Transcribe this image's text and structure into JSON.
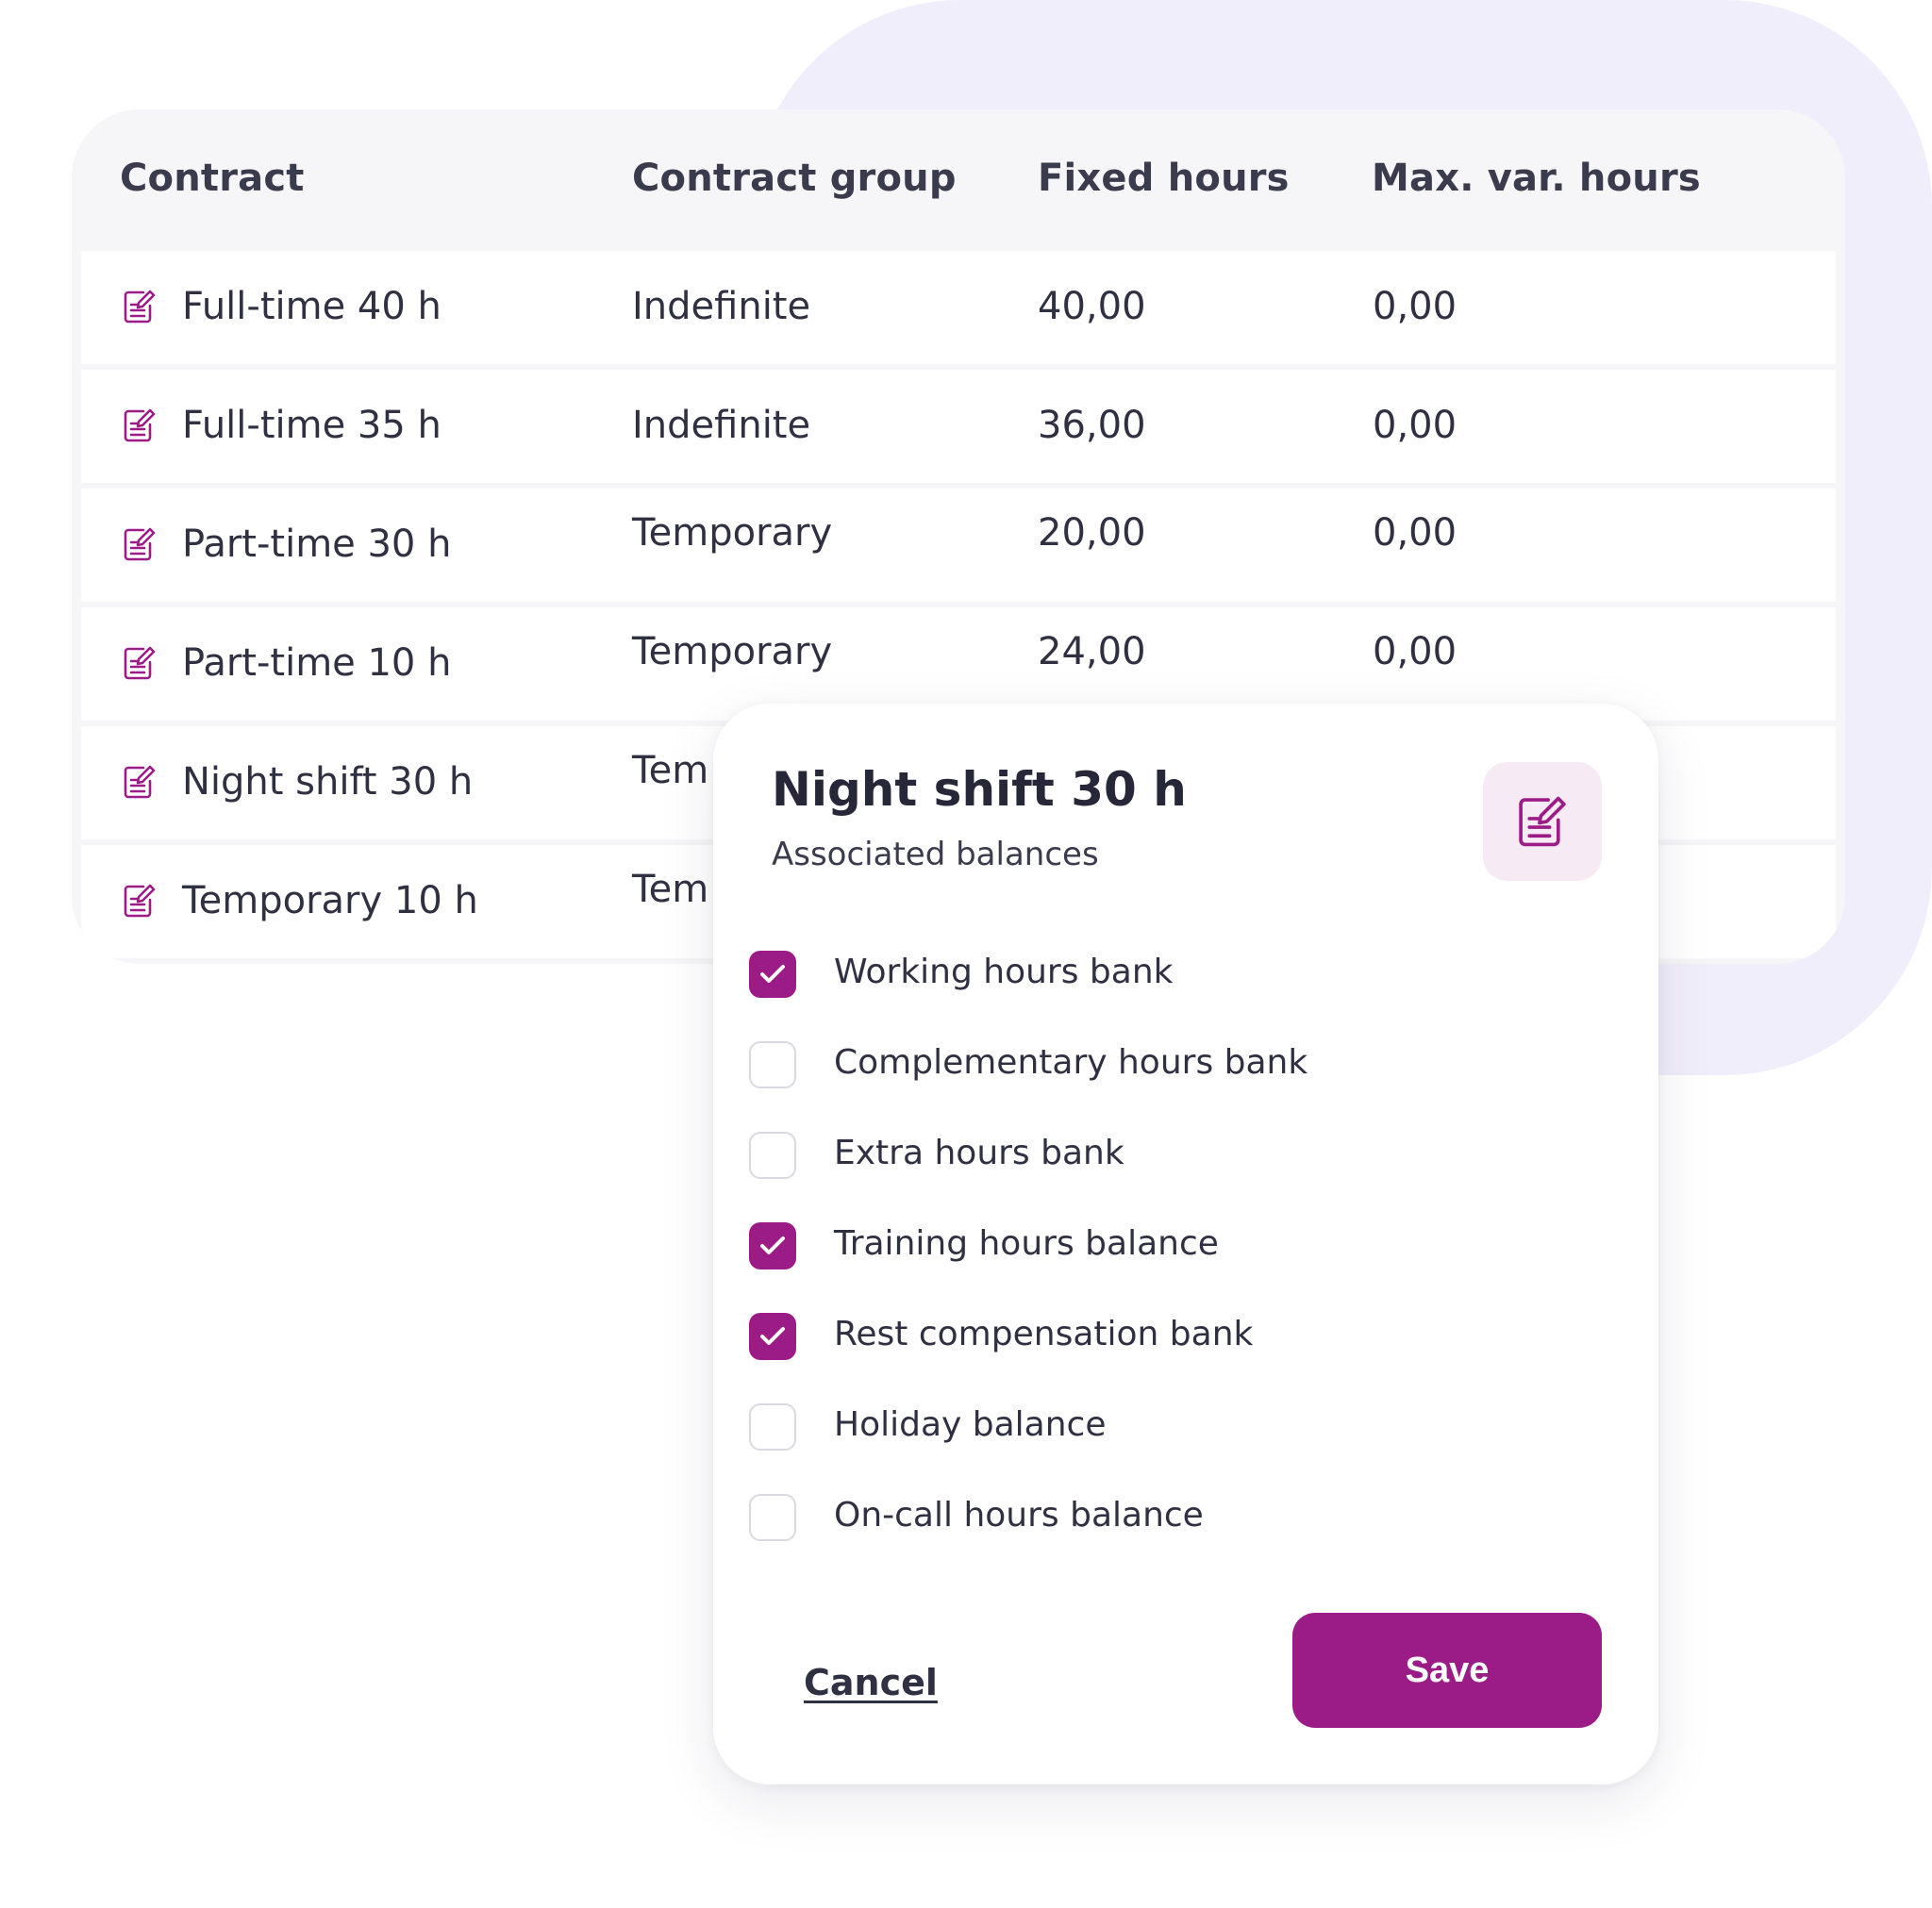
{
  "colors": {
    "accent": "#9c1c87",
    "accent_soft": "#f6eaf5",
    "background_shape": "#f1eefb",
    "table_header_bg": "#f6f6f8",
    "text": "#2f3042"
  },
  "table": {
    "columns": [
      "Contract",
      "Contract group",
      "Fixed hours",
      "Max. var. hours"
    ],
    "rows": [
      {
        "icon": "edit-contract-icon",
        "contract": "Full-time 40 h",
        "group": "Indefinite",
        "fixed": "40,00",
        "max_var": "0,00"
      },
      {
        "icon": "edit-contract-icon",
        "contract": "Full-time 35 h",
        "group": "Indefinite",
        "fixed": "36,00",
        "max_var": "0,00"
      },
      {
        "icon": "edit-contract-icon",
        "contract": "Part-time 30 h",
        "group": "Temporary",
        "fixed": "20,00",
        "max_var": "0,00"
      },
      {
        "icon": "edit-contract-icon",
        "contract": "Part-time 10 h",
        "group": "Temporary",
        "fixed": "24,00",
        "max_var": "0,00"
      },
      {
        "icon": "edit-contract-icon",
        "contract": "Night shift 30 h",
        "group": "Tem",
        "fixed": "",
        "max_var": ""
      },
      {
        "icon": "edit-contract-icon",
        "contract": "Temporary 10 h",
        "group": "Tem",
        "fixed": "",
        "max_var": ""
      }
    ]
  },
  "modal": {
    "title": "Night shift 30 h",
    "subtitle": "Associated balances",
    "edit_icon": "edit-contract-icon",
    "options": [
      {
        "label": "Working hours bank",
        "checked": true
      },
      {
        "label": "Complementary hours bank",
        "checked": false
      },
      {
        "label": "Extra hours bank",
        "checked": false
      },
      {
        "label": "Training hours balance",
        "checked": true
      },
      {
        "label": "Rest compensation bank",
        "checked": true
      },
      {
        "label": "Holiday balance",
        "checked": false
      },
      {
        "label": "On-call hours balance",
        "checked": false
      }
    ],
    "cancel_label": "Cancel",
    "save_label": "Save"
  }
}
